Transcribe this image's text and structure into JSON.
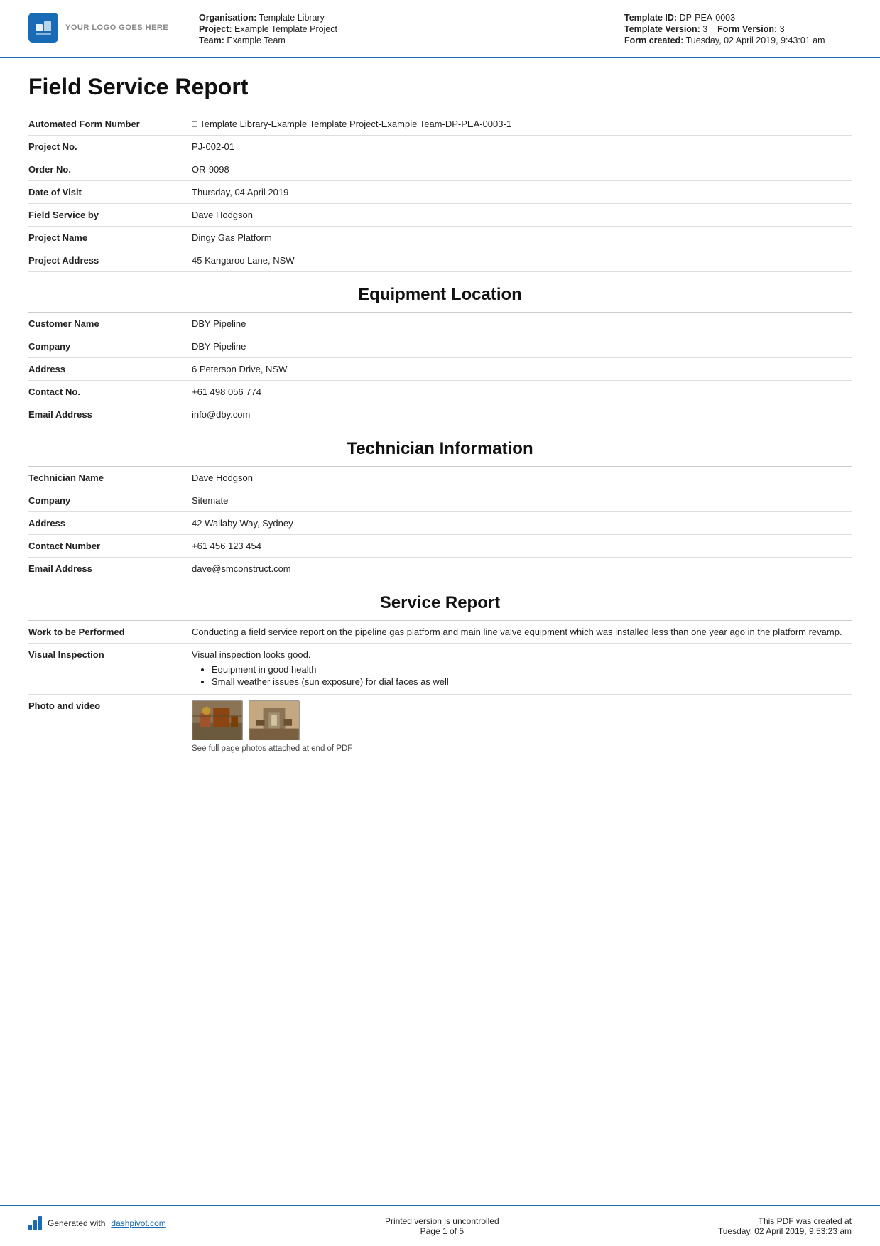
{
  "header": {
    "logo_text": "YOUR LOGO GOES HERE",
    "org_label": "Organisation:",
    "org_value": "Template Library",
    "project_label": "Project:",
    "project_value": "Example Template Project",
    "team_label": "Team:",
    "team_value": "Example Team",
    "template_id_label": "Template ID:",
    "template_id_value": "DP-PEA-0003",
    "template_version_label": "Template Version:",
    "template_version_value": "3",
    "form_version_label": "Form Version:",
    "form_version_value": "3",
    "form_created_label": "Form created:",
    "form_created_value": "Tuesday, 02 April 2019, 9:43:01 am"
  },
  "page_title": "Field Service Report",
  "form_fields": [
    {
      "label": "Automated Form Number",
      "value": "□ Template Library-Example Template Project-Example Team-DP-PEA-0003-1"
    },
    {
      "label": "Project No.",
      "value": "PJ-002-01"
    },
    {
      "label": "Order No.",
      "value": "OR-9098"
    },
    {
      "label": "Date of Visit",
      "value": "Thursday, 04 April 2019"
    },
    {
      "label": "Field Service by",
      "value": "Dave Hodgson"
    },
    {
      "label": "Project Name",
      "value": "Dingy Gas Platform"
    },
    {
      "label": "Project Address",
      "value": "45 Kangaroo Lane, NSW"
    }
  ],
  "equipment_section": {
    "heading": "Equipment Location",
    "fields": [
      {
        "label": "Customer Name",
        "value": "DBY Pipeline"
      },
      {
        "label": "Company",
        "value": "DBY Pipeline"
      },
      {
        "label": "Address",
        "value": "6 Peterson Drive, NSW"
      },
      {
        "label": "Contact No.",
        "value": "+61 498 056 774"
      },
      {
        "label": "Email Address",
        "value": "info@dby.com"
      }
    ]
  },
  "technician_section": {
    "heading": "Technician Information",
    "fields": [
      {
        "label": "Technician Name",
        "value": "Dave Hodgson"
      },
      {
        "label": "Company",
        "value": "Sitemate"
      },
      {
        "label": "Address",
        "value": "42 Wallaby Way, Sydney"
      },
      {
        "label": "Contact Number",
        "value": "+61 456 123 454"
      },
      {
        "label": "Email Address",
        "value": "dave@smconstruct.com"
      }
    ]
  },
  "service_section": {
    "heading": "Service Report",
    "fields": [
      {
        "label": "Work to be Performed",
        "value": "Conducting a field service report on the pipeline gas platform and main line valve equipment which was installed less than one year ago in the platform revamp.",
        "type": "text"
      },
      {
        "label": "Visual Inspection",
        "value": "Visual inspection looks good.",
        "bullets": [
          "Equipment in good health",
          "Small weather issues (sun exposure) for dial faces as well"
        ],
        "type": "bullets"
      },
      {
        "label": "Photo and video",
        "caption": "See full page photos attached at end of PDF",
        "type": "photos"
      }
    ]
  },
  "footer": {
    "generated_with": "Generated with ",
    "link_text": "dashpivot.com",
    "center_line1": "Printed version is uncontrolled",
    "center_line2": "Page 1 of 5",
    "right_line1": "This PDF was created at",
    "right_line2": "Tuesday, 02 April 2019, 9:53:23 am"
  }
}
